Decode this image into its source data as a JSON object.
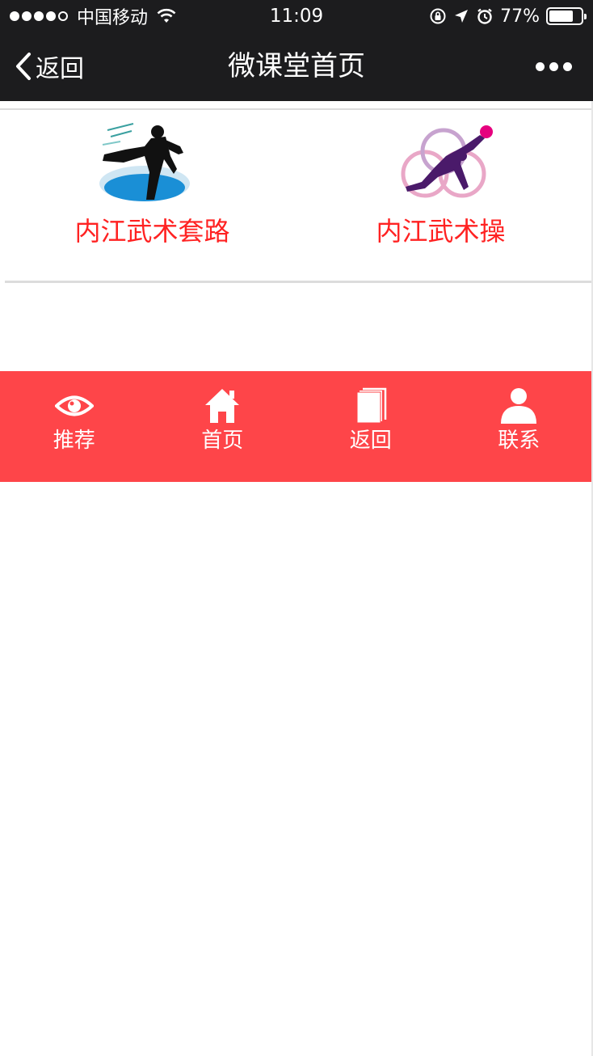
{
  "status_bar": {
    "carrier": "中国移动",
    "time": "11:09",
    "battery": "77%",
    "battery_level": 0.77,
    "signal_bars_filled": 4,
    "signal_bars_total": 5,
    "icons": [
      "wifi-icon",
      "rotation-lock-icon",
      "location-arrow-icon",
      "alarm-icon",
      "battery-icon"
    ]
  },
  "nav": {
    "back_label": "返回",
    "title": "微课堂首页",
    "back_icon": "chevron-left-icon",
    "more_icon": "more-dots-icon"
  },
  "categories": [
    {
      "label": "内江武术套路",
      "image": "martial-arts-kick-silhouette"
    },
    {
      "label": "内江武术操",
      "image": "gymnastics-ribbon-silhouette"
    }
  ],
  "tabbar": {
    "items": [
      {
        "label": "推荐",
        "icon": "eye-icon"
      },
      {
        "label": "首页",
        "icon": "home-icon"
      },
      {
        "label": "返回",
        "icon": "book-icon"
      },
      {
        "label": "联系",
        "icon": "person-icon"
      }
    ]
  },
  "colors": {
    "bar_background": "#1c1c1e",
    "tabbar_background": "#fe4549",
    "category_label": "#ff2222",
    "divider": "#dcdcdc"
  }
}
